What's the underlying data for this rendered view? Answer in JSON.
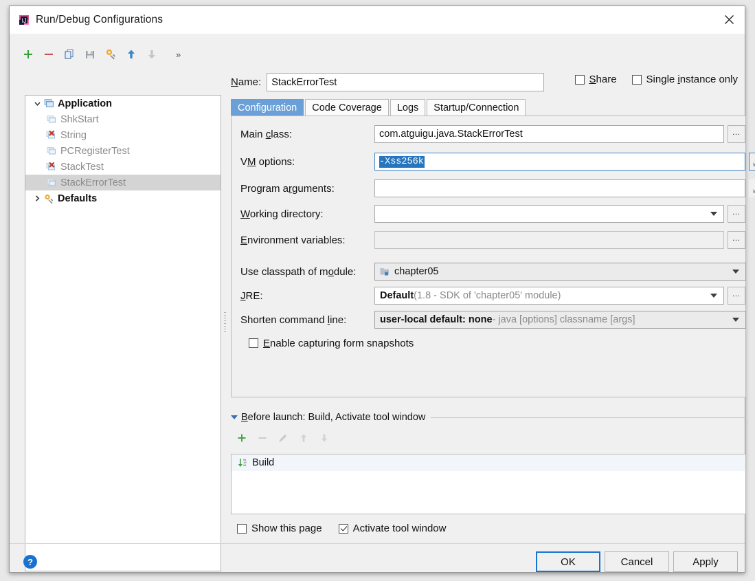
{
  "window": {
    "title": "Run/Debug Configurations",
    "app_icon": "intellij-idea-icon",
    "close_icon": "close-icon"
  },
  "toolbar": {
    "items": [
      {
        "name": "add-configuration-button",
        "icon": "plus-icon",
        "label": "+"
      },
      {
        "name": "remove-configuration-button",
        "icon": "minus-icon",
        "label": "−"
      },
      {
        "name": "copy-configuration-button",
        "icon": "copy-icon",
        "label": "Copy"
      },
      {
        "name": "save-configuration-button",
        "icon": "save-icon",
        "label": "Save"
      },
      {
        "name": "edit-templates-button",
        "icon": "gear-wrench-icon",
        "label": "Edit defaults"
      },
      {
        "name": "move-up-button",
        "icon": "arrow-up-icon",
        "label": "Move Up"
      },
      {
        "name": "move-down-button",
        "icon": "arrow-down-icon",
        "label": "Move Down"
      }
    ],
    "overflow_label": "»"
  },
  "tree": {
    "root": {
      "label": "Application",
      "expanded": true,
      "icon": "application-icon",
      "children": [
        {
          "label": "ShkStart",
          "icon": "application-icon",
          "error": false,
          "selected": false
        },
        {
          "label": "String",
          "icon": "application-error-icon",
          "error": true,
          "selected": false
        },
        {
          "label": "PCRegisterTest",
          "icon": "application-icon",
          "error": false,
          "selected": false
        },
        {
          "label": "StackTest",
          "icon": "application-error-icon",
          "error": true,
          "selected": false
        },
        {
          "label": "StackErrorTest",
          "icon": "application-icon",
          "error": false,
          "selected": true
        }
      ]
    },
    "defaults": {
      "label": "Defaults",
      "expanded": false,
      "icon": "gear-wrench-icon"
    }
  },
  "name_row": {
    "label": "Name:",
    "label_mnemonic": "N",
    "value": "StackErrorTest",
    "placeholder": ""
  },
  "options": {
    "share": {
      "label": "Share",
      "mnemonic": "S",
      "checked": false
    },
    "single_instance": {
      "label_before": "Single ",
      "mnemonic": "i",
      "label_after": "nstance only",
      "checked": false
    }
  },
  "tabs": [
    {
      "label": "Configuration",
      "active": true
    },
    {
      "label": "Code Coverage",
      "active": false
    },
    {
      "label": "Logs",
      "active": false
    },
    {
      "label": "Startup/Connection",
      "active": false
    }
  ],
  "configuration": {
    "main_class": {
      "label_before": "Main ",
      "mnemonic": "c",
      "label_after": "lass:",
      "value": "com.atguigu.java.StackErrorTest",
      "browse_label": "•••"
    },
    "vm_options": {
      "label_before": "V",
      "mnemonic": "M",
      "label_after": " options:",
      "value": "-Xss256k",
      "selected": true,
      "expand_icon": "expand-icon",
      "focused": true
    },
    "program_arguments": {
      "label_before": "Program a",
      "mnemonic": "r",
      "label_after": "guments:",
      "value": "",
      "expand_icon": "expand-icon"
    },
    "working_directory": {
      "label_before": "",
      "mnemonic": "W",
      "label_after": "orking directory:",
      "value": "",
      "browse_label": "•••"
    },
    "environment_variables": {
      "label_before": "",
      "mnemonic": "E",
      "label_after": "nvironment variables:",
      "value": "",
      "disabled": true,
      "browse_label": "•••"
    },
    "classpath_module": {
      "label_before": "Use classpath of m",
      "mnemonic": "o",
      "label_after": "dule:",
      "value": "chapter05",
      "icon": "module-icon"
    },
    "jre": {
      "label_before": "",
      "mnemonic": "J",
      "label_after": "RE:",
      "value": "Default",
      "value_sub": " (1.8 - SDK of 'chapter05' module)",
      "browse_label": "•••"
    },
    "shorten_command_line": {
      "label_before": "Shorten command ",
      "mnemonic": "l",
      "label_after": "ine:",
      "value": "user-local default: none",
      "value_sub": " - java [options] classname [args]"
    },
    "form_snapshots": {
      "label_before": "",
      "mnemonic": "E",
      "label_after": "nable capturing form snapshots",
      "checked": false
    }
  },
  "before_launch": {
    "title_mnemonic": "B",
    "title": "efore launch: Build, Activate tool window",
    "expanded": true,
    "toolbar": [
      {
        "name": "add-task-button",
        "icon": "plus-icon",
        "enabled": true
      },
      {
        "name": "remove-task-button",
        "icon": "minus-icon",
        "enabled": false
      },
      {
        "name": "edit-task-button",
        "icon": "pencil-icon",
        "enabled": false
      },
      {
        "name": "task-move-up-button",
        "icon": "arrow-up-icon",
        "enabled": false
      },
      {
        "name": "task-move-down-button",
        "icon": "arrow-down-icon",
        "enabled": false
      }
    ],
    "items": [
      {
        "label": "Build",
        "icon": "build-icon"
      }
    ]
  },
  "bottom_options": {
    "show_this_page": {
      "label": "Show this page",
      "checked": false
    },
    "activate_tool_window": {
      "label": "Activate tool window",
      "checked": true
    }
  },
  "footer": {
    "help_label": "?",
    "buttons": [
      {
        "label": "OK",
        "default": true,
        "name": "ok-button"
      },
      {
        "label": "Cancel",
        "default": false,
        "name": "cancel-button"
      },
      {
        "label": "Apply",
        "default": false,
        "name": "apply-button"
      }
    ]
  },
  "colors": {
    "accent": "#1773cf",
    "tab_active": "#6a9fd8",
    "selection": "#2675bf",
    "tree_selection": "#d4d4d4",
    "dialog_bg": "#f0f0f0"
  }
}
